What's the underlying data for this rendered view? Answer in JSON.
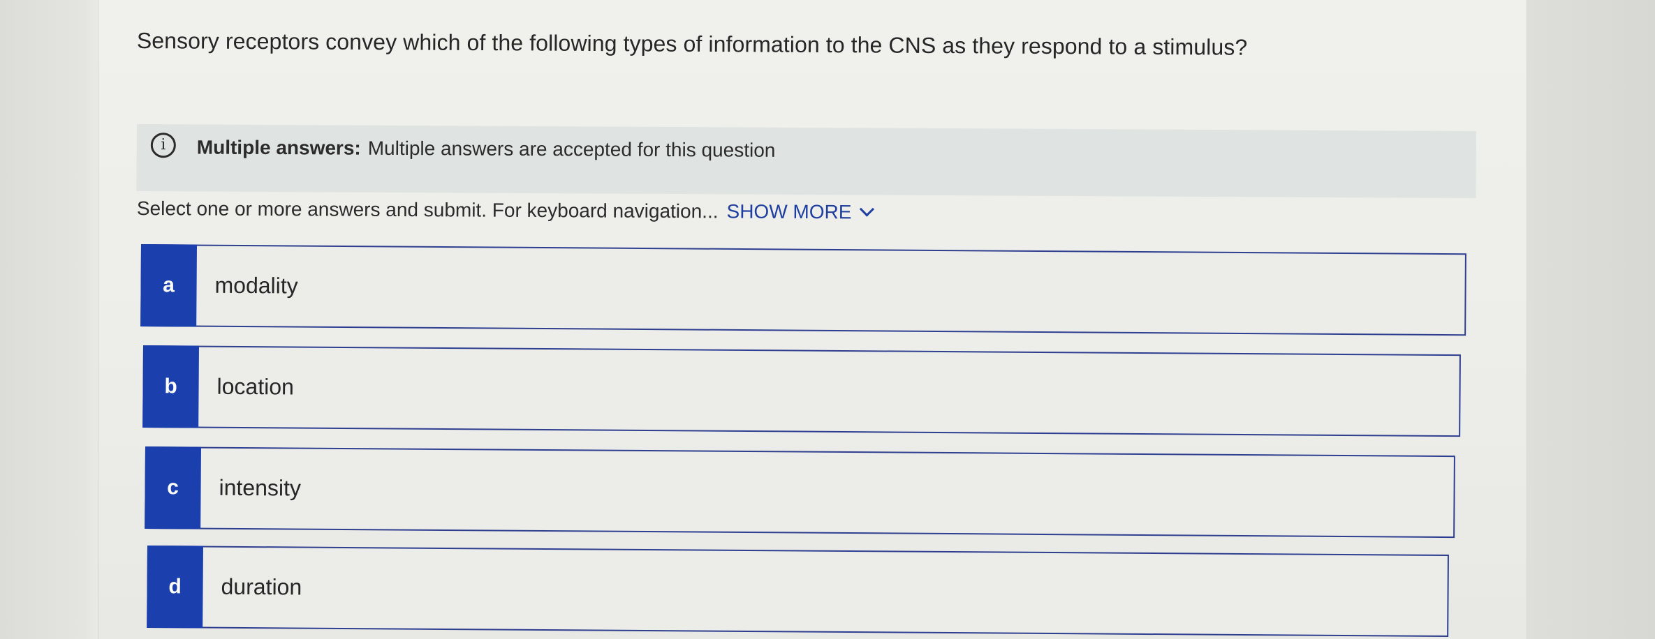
{
  "question": {
    "text": "Sensory receptors convey which of the following types of information to the CNS as they respond to a stimulus?"
  },
  "info": {
    "icon": "info-icon",
    "icon_glyph": "i",
    "label": "Multiple answers:",
    "text": "Multiple answers are accepted for this question"
  },
  "instructions": {
    "text": "Select one or more answers and submit. For keyboard navigation...",
    "show_more": "SHOW MORE"
  },
  "options": [
    {
      "letter": "a",
      "text": "modality"
    },
    {
      "letter": "b",
      "text": "location"
    },
    {
      "letter": "c",
      "text": "intensity"
    },
    {
      "letter": "d",
      "text": "duration"
    }
  ],
  "colors": {
    "accent": "#1c3fae",
    "link": "#1f3fa0",
    "info_bg": "#dfe3e2"
  }
}
